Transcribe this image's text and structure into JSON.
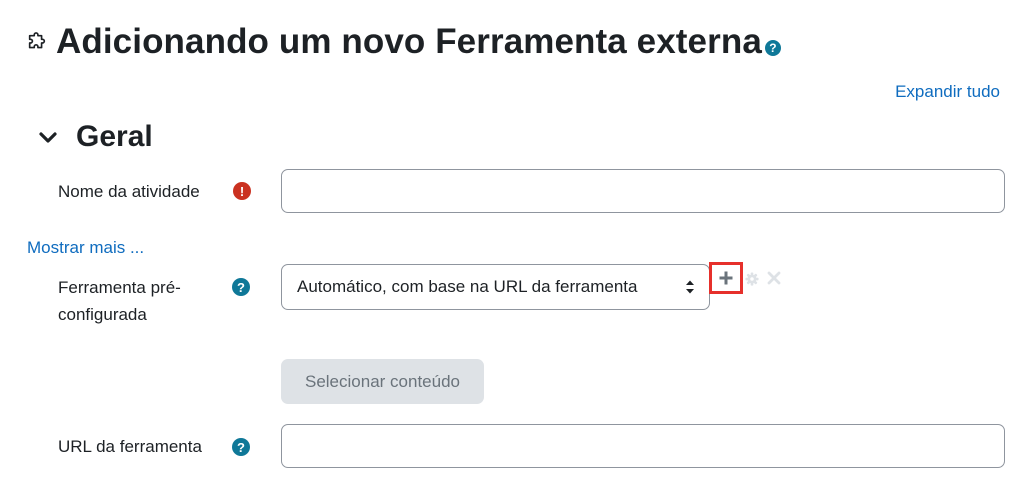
{
  "page": {
    "title": "Adicionando um novo Ferramenta externa",
    "title_icon": "puzzle-icon",
    "help_icon": "question-icon"
  },
  "toolbar": {
    "expand_all": "Expandir tudo"
  },
  "section": {
    "title": "Geral",
    "collapse_icon": "chevron-down-icon"
  },
  "fields": {
    "activity_name": {
      "label": "Nome da atividade",
      "value": "",
      "icon": "required-icon",
      "icon_color": "#ca3120"
    },
    "show_more": "Mostrar mais ...",
    "preconfigured_tool": {
      "label_line1": "Ferramenta pré-",
      "label_line2": "configurada",
      "selected": "Automático, com base na URL da ferramenta",
      "icon": "question-icon",
      "actions": [
        "add-icon",
        "gear-icon",
        "close-icon"
      ]
    },
    "select_content": {
      "label": "Selecionar conteúdo"
    },
    "tool_url": {
      "label": "URL da ferramenta",
      "value": "",
      "icon": "question-icon"
    }
  },
  "colors": {
    "link": "#0f6cbf",
    "help": "#0f7898",
    "required": "#ca3120",
    "highlight": "#e6302b"
  }
}
